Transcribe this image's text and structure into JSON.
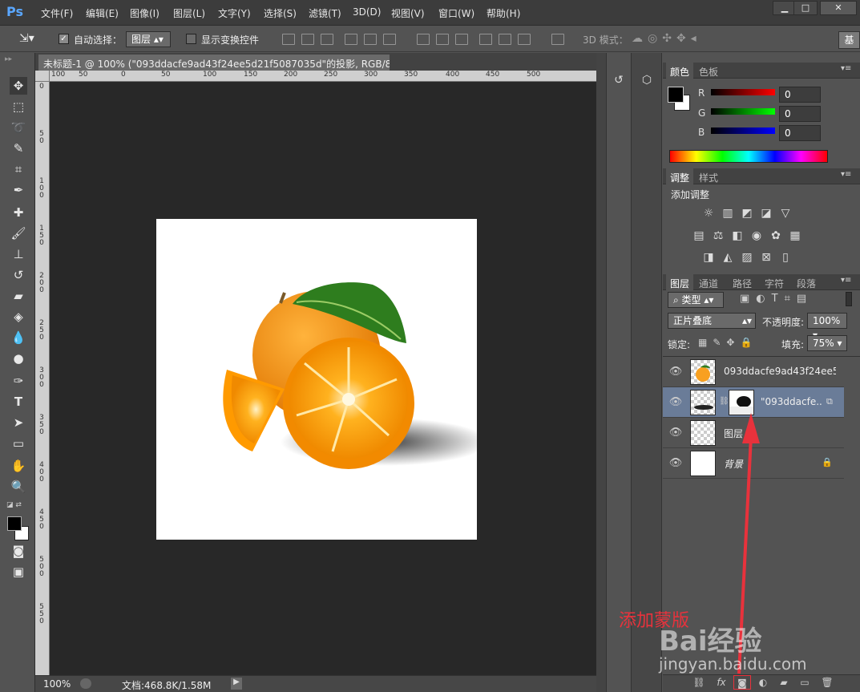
{
  "app": {
    "logo": "Ps"
  },
  "menu": [
    "文件(F)",
    "编辑(E)",
    "图像(I)",
    "图层(L)",
    "文字(Y)",
    "选择(S)",
    "滤镜(T)",
    "3D(D)",
    "视图(V)",
    "窗口(W)",
    "帮助(H)"
  ],
  "window_controls": {
    "minimize": "▁",
    "maximize": "□",
    "close": "✕"
  },
  "options": {
    "auto_select_label": "自动选择：",
    "auto_select_checked": true,
    "auto_select_target": "图层",
    "transform_controls_label": "显示变换控件",
    "mode3d_label": "3D 模式：",
    "workspace_label": "基"
  },
  "document": {
    "tab_title": "未标题-1 @ 100% (\"093ddacfe9ad43f24ee5d21f5087035d\"的投影, RGB/8) *",
    "zoom": "100%",
    "doc_info": "文档:468.8K/1.58M"
  },
  "ruler": {
    "h_ticks": [
      "100",
      "50",
      "0",
      "50",
      "100",
      "150",
      "200",
      "250",
      "300",
      "350",
      "400",
      "450",
      "500"
    ],
    "v_ticks": [
      "0",
      "5 0",
      "1 0 0",
      "1 5 0",
      "2 0 0",
      "2 5 0",
      "3 0 0",
      "3 5 0",
      "4 0 0",
      "4 5 0",
      "5 0 0",
      "5 5 0"
    ]
  },
  "color_panel": {
    "tabs": [
      "颜色",
      "色板"
    ],
    "active_tab": "颜色",
    "channels": [
      {
        "label": "R",
        "value": "0",
        "color": "#e02020"
      },
      {
        "label": "G",
        "value": "0",
        "color": "#20c020"
      },
      {
        "label": "B",
        "value": "0",
        "color": "#2020e0"
      }
    ]
  },
  "adjust_panel": {
    "tabs": [
      "调整",
      "样式"
    ],
    "active_tab": "调整",
    "heading": "添加调整"
  },
  "layers_panel": {
    "tabs": [
      "图层",
      "通道",
      "路径",
      "字符",
      "段落"
    ],
    "active_tab": "图层",
    "filter_kind": "类型",
    "blend_mode": "正片叠底",
    "opacity_label": "不透明度:",
    "opacity": "100%",
    "lock_label": "锁定:",
    "fill_label": "填充:",
    "fill": "75%",
    "layers": [
      {
        "name": "093ddacfe9ad43f24ee5d...",
        "selected": false
      },
      {
        "name": "\"093ddacfe...",
        "selected": true
      },
      {
        "name": "图层 ",
        "selected": false
      },
      {
        "name": "背景",
        "selected": false
      }
    ]
  },
  "annotation": {
    "text": "添加蒙版",
    "color": "#e8323c"
  },
  "watermark": {
    "brand": "Bai经验",
    "url": "jingyan.baidu.com"
  }
}
